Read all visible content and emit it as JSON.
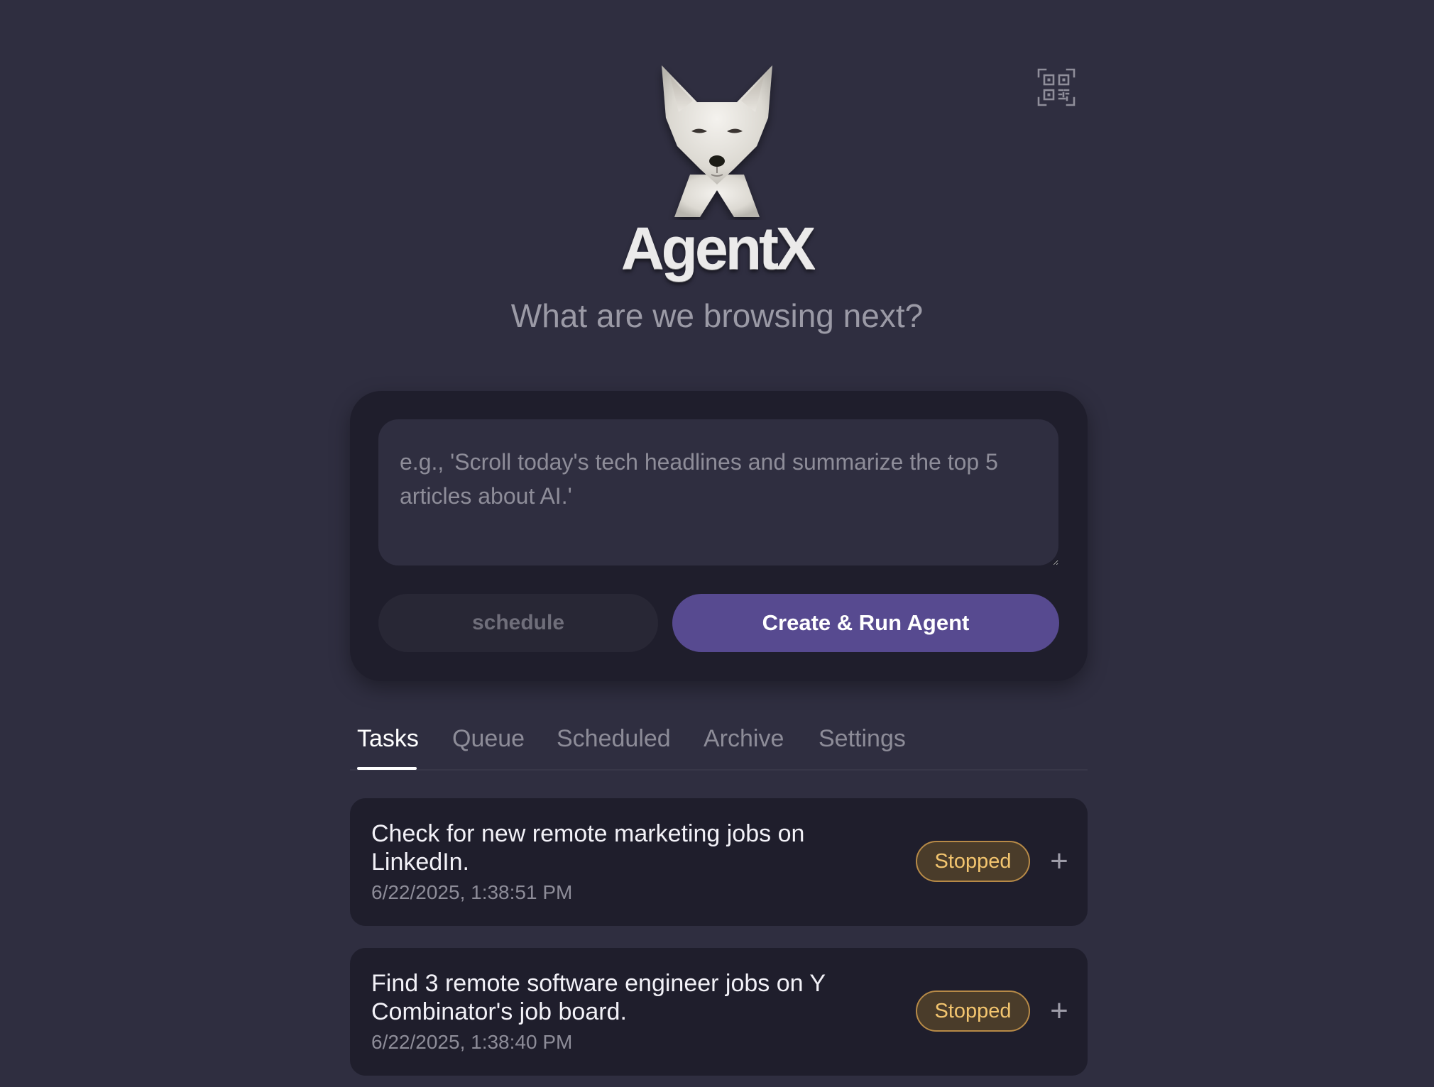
{
  "header": {
    "brand": "AgentX",
    "subtitle": "What are we browsing next?",
    "logo_icon": "fox-logo-icon",
    "qr_icon": "qr-code-icon"
  },
  "composer": {
    "placeholder": "e.g., 'Scroll today's tech headlines and summarize the top 5 articles about AI.'",
    "value": "",
    "schedule_label": "schedule",
    "run_label": "Create & Run Agent"
  },
  "tabs": [
    {
      "label": "Tasks",
      "active": true
    },
    {
      "label": "Queue",
      "active": false
    },
    {
      "label": "Scheduled",
      "active": false
    },
    {
      "label": "Archive",
      "active": false
    },
    {
      "label": "Settings",
      "active": false
    }
  ],
  "tasks": [
    {
      "title": "Check for new remote marketing jobs on LinkedIn.",
      "timestamp": "6/22/2025, 1:38:51 PM",
      "status": "Stopped",
      "action_icon": "plus-icon"
    },
    {
      "title": "Find 3 remote software engineer jobs on Y Combinator's job board.",
      "timestamp": "6/22/2025, 1:38:40 PM",
      "status": "Stopped",
      "action_icon": "plus-icon"
    }
  ],
  "colors": {
    "background": "#2f2e40",
    "card": "#1f1e2c",
    "accent": "#574a90",
    "status_stopped_text": "#f3c56f",
    "status_stopped_border": "#b78a47"
  }
}
